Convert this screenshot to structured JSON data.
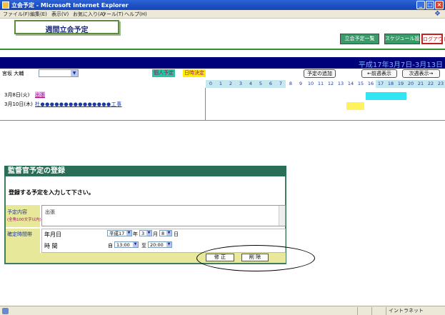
{
  "window": {
    "title": "立会予定 - Microsoft Internet Explorer",
    "menu": [
      "ファイル(F)",
      "編集(E)",
      "表示(V)",
      "お気に入り(A)",
      "ツール(T)",
      "ヘルプ(H)"
    ]
  },
  "header": {
    "page_title": "週間立会予定",
    "btn_a": "立会予定一覧",
    "btn_b": "スケジュール設定",
    "btn_c": "ログアウト"
  },
  "date_range": "平成17年3月7日-3月13日",
  "user": {
    "name": "宮坂 大輔",
    "legend_personal": "個人予定",
    "legend_date": "日時決定",
    "add_button": "予定の追加",
    "prev_week_button": "←前週表示",
    "next_week_button": "次週表示→"
  },
  "hours": [
    "0",
    "1",
    "2",
    "3",
    "4",
    "5",
    "6",
    "7",
    "8",
    "9",
    "10",
    "11",
    "12",
    "13",
    "14",
    "15",
    "16",
    "17",
    "18",
    "19",
    "20",
    "21",
    "22",
    "23"
  ],
  "schedule": [
    {
      "date": "3月8日(火)",
      "entry": "出張"
    },
    {
      "date": "3月10日(木)",
      "entry": "杜●●●●●●●●●●●●●●●工事"
    }
  ],
  "form": {
    "title": "監督官予定の登録",
    "instruction": "登録する予定を入力して下さい。",
    "content_label": "予定内容",
    "content_note": "(全角100文字以内)",
    "content_value": "出張",
    "time_label": "確定時間帯",
    "date_label": "年月日",
    "time_row_label": "時 間",
    "era": "平成",
    "year": "17",
    "year_unit": "年",
    "month": "3",
    "month_unit": "月",
    "day": "8",
    "day_unit": "日",
    "from_prefix": "自",
    "from_time": "13:00",
    "to_prefix": "至",
    "to_time": "20:00",
    "modify_button": "修 正",
    "delete_button": "削 除"
  },
  "status": {
    "zone": "イントラネット"
  }
}
